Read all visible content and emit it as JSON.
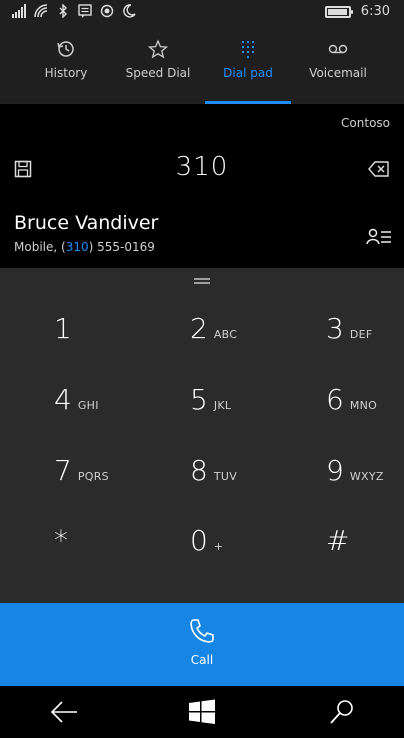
{
  "status_bar": {
    "time": "6:30"
  },
  "tabs": [
    {
      "label": "History",
      "icon": "history-icon"
    },
    {
      "label": "Speed Dial",
      "icon": "star-icon"
    },
    {
      "label": "Dial pad",
      "icon": "dialpad-icon"
    },
    {
      "label": "Voicemail",
      "icon": "voicemail-icon"
    }
  ],
  "active_tab": "Dial pad",
  "dial": {
    "account": "Contoso",
    "number": "310"
  },
  "suggestion": {
    "name": "Bruce Vandiver",
    "label_prefix": "Mobile, (",
    "match": "310",
    "label_suffix": ") 555-0169"
  },
  "keys": [
    {
      "digit": "1",
      "letters": ""
    },
    {
      "digit": "2",
      "letters": "ABC"
    },
    {
      "digit": "3",
      "letters": "DEF"
    },
    {
      "digit": "4",
      "letters": "GHI"
    },
    {
      "digit": "5",
      "letters": "JKL"
    },
    {
      "digit": "6",
      "letters": "MNO"
    },
    {
      "digit": "7",
      "letters": "PQRS"
    },
    {
      "digit": "8",
      "letters": "TUV"
    },
    {
      "digit": "9",
      "letters": "WXYZ"
    },
    {
      "digit": "*",
      "letters": ""
    },
    {
      "digit": "0",
      "letters": "+"
    },
    {
      "digit": "#",
      "letters": ""
    }
  ],
  "call": {
    "label": "Call"
  },
  "colors": {
    "accent": "#1c8cff",
    "call_bar": "#1685e3",
    "pad_bg": "#2b2b2b",
    "header_bg": "#1f1f1f"
  }
}
